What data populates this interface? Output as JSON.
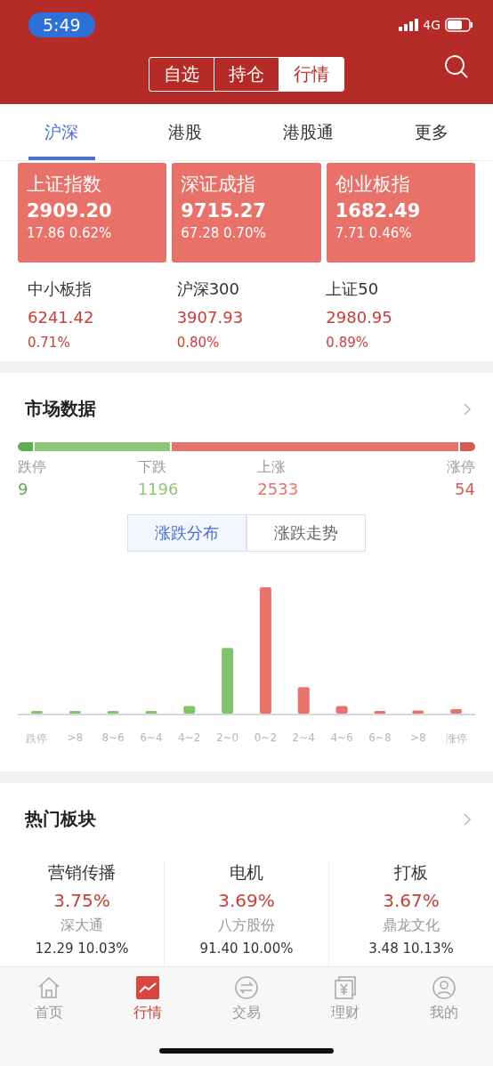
{
  "status_bar": {
    "time": "5:49",
    "network": "4G"
  },
  "header": {
    "segments": [
      {
        "label": "自选",
        "selected": false
      },
      {
        "label": "持仓",
        "selected": false
      },
      {
        "label": "行情",
        "selected": true
      }
    ]
  },
  "market_tabs": [
    {
      "label": "沪深",
      "selected": true
    },
    {
      "label": "港股",
      "selected": false
    },
    {
      "label": "港股通",
      "selected": false
    },
    {
      "label": "更多",
      "selected": false
    }
  ],
  "main_indices": [
    {
      "name": "上证指数",
      "value": "2909.20",
      "change": "17.86 0.62%"
    },
    {
      "name": "深证成指",
      "value": "9715.27",
      "change": "67.28 0.70%"
    },
    {
      "name": "创业板指",
      "value": "1682.49",
      "change": "7.71 0.46%"
    }
  ],
  "other_indices": [
    {
      "name": "中小板指",
      "value": "6241.42",
      "change": "0.71%"
    },
    {
      "name": "沪深300",
      "value": "3907.93",
      "change": "0.80%"
    },
    {
      "name": "上证50",
      "value": "2980.95",
      "change": "0.89%"
    }
  ],
  "market_data": {
    "title": "市场数据",
    "breadth": [
      {
        "label": "跌停",
        "count": "9",
        "color": "#5cae4f"
      },
      {
        "label": "下跌",
        "count": "1196",
        "color": "#8cc878"
      },
      {
        "label": "上涨",
        "count": "2533",
        "color": "#e8736a"
      },
      {
        "label": "涨停",
        "count": "54",
        "color": "#d65a50"
      }
    ],
    "views": [
      {
        "label": "涨跌分布",
        "selected": true
      },
      {
        "label": "涨跌走势",
        "selected": false
      }
    ],
    "distribution_labels": [
      "跌停",
      ">8",
      "8~6",
      "6~4",
      "4~2",
      "2~0",
      "0~2",
      "2~4",
      "4~6",
      "6~8",
      ">8",
      "涨停"
    ]
  },
  "hot_sectors": {
    "title": "热门板块",
    "items": [
      {
        "name": "营销传播",
        "change": "3.75%",
        "leader": "深大通",
        "leader_quote": "12.29 10.03%"
      },
      {
        "name": "电机",
        "change": "3.69%",
        "leader": "八方股份",
        "leader_quote": "91.40 10.00%"
      },
      {
        "name": "打板",
        "change": "3.67%",
        "leader": "鼎龙文化",
        "leader_quote": "3.48 10.13%"
      }
    ]
  },
  "bottom_nav": [
    {
      "label": "首页",
      "selected": false
    },
    {
      "label": "行情",
      "selected": true
    },
    {
      "label": "交易",
      "selected": false
    },
    {
      "label": "理财",
      "selected": false
    },
    {
      "label": "我的",
      "selected": false
    }
  ]
}
